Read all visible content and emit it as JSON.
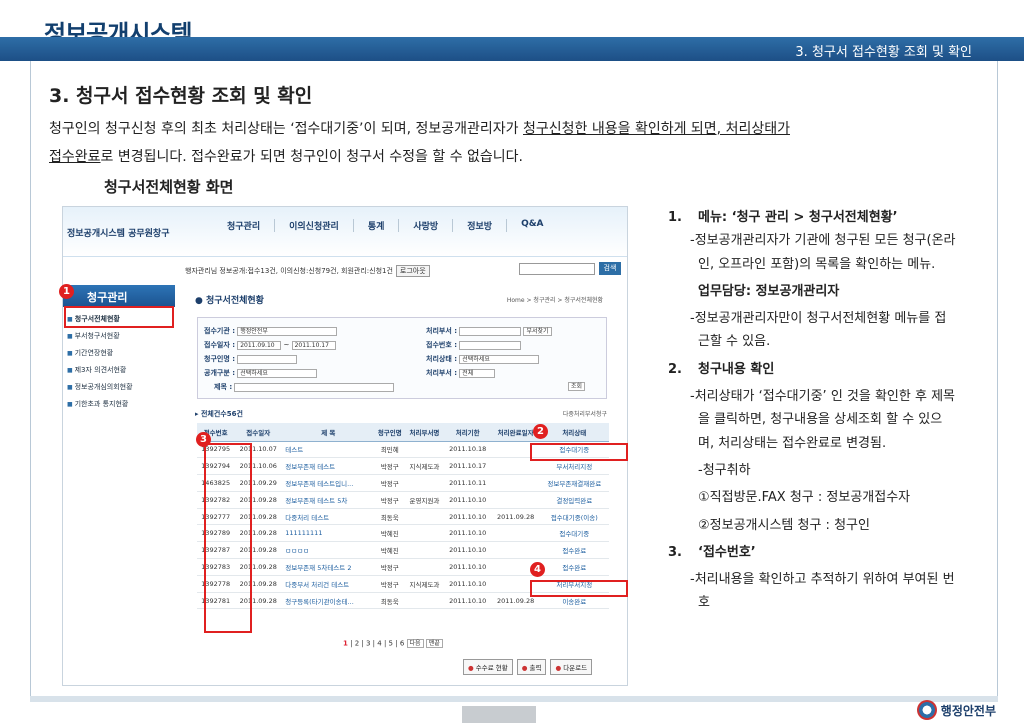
{
  "header": {
    "logo": "정보공개시스템",
    "section": "3. 청구서 접수현황 조회 및 확인"
  },
  "main": {
    "title": "3. 청구서 접수현황 조회 및 확인",
    "para_plain1": "  청구인의 청구신청 후의 최초 처리상태는 ‘접수대기중’이 되며, 정보공개관리자가 ",
    "para_u1": "청구신청한 내용을 확인하게 되면, 처리상태가",
    "para_u2": "접수완료",
    "para_plain2": "로 변경됩니다. 접수완료가 되면 청구인이 청구서 수정을 할 수 없습니다.",
    "subtitle": "청구서전체현황 화면"
  },
  "shot": {
    "site_title": "정보공개시스템 공무원창구",
    "nav": [
      "청구관리",
      "이의신청관리",
      "통계",
      "사랑방",
      "정보방",
      "Q&A"
    ],
    "user_info": "행자관리님    정보공개:접수13건, 이의신청:신청79건, 회원관리:신청1건",
    "logout": "로그아웃",
    "search_btn": "검색",
    "side_head": "청구관리",
    "side_items": [
      "청구서전체현황",
      "부서청구서현황",
      "기간연장현황",
      "제3자 의견서현황",
      "정보공개심의회현황",
      "기한초과 통지현황"
    ],
    "crumb_title": "청구서전체현황",
    "path": "Home > 청구관리 > 청구서전체현황",
    "form": {
      "agency_l": "접수기관 :",
      "agency_v": "행정안전부",
      "date_l": "접수일자 :",
      "date_from": "2011.09.10",
      "date_sep": "~",
      "date_to": "2011.10.17",
      "name_l": "청구인명 :",
      "type_l": "공개구분 :",
      "type_v": "선택하세요",
      "title_l": "제목 :",
      "dept_l": "처리부서 :",
      "dept_btn": "부서찾기",
      "recv_l": "접수번호 :",
      "state_l": "처리상태 :",
      "state_v": "선택하세요",
      "mgr_l": "처리부서 :",
      "mgr_v": "전체",
      "query_btn": "조회"
    },
    "count": "전체건수56건",
    "multi_dl": "다중처리부서청구",
    "columns": [
      "접수번호",
      "접수일자",
      "제 목",
      "청구인명",
      "처리부서명",
      "처리기한",
      "처리완료일자",
      "처리상태"
    ],
    "rows": [
      [
        "1392795",
        "2011.10.07",
        "테스트",
        "최민혜",
        "",
        "2011.10.18",
        "",
        "접수대기중"
      ],
      [
        "1392794",
        "2011.10.06",
        "정보부존재 테스트",
        "박정구",
        "지식제도과",
        "2011.10.17",
        "",
        "부서처리지정"
      ],
      [
        "1463825",
        "2011.09.29",
        "정보부존재 테스트입니...",
        "박정구",
        "",
        "2011.10.11",
        "",
        "정보부존재결재완료"
      ],
      [
        "1392782",
        "2011.09.28",
        "정보부존재 테스트 5차",
        "박정구",
        "운영지원과",
        "2011.10.10",
        "",
        "결정입력완료"
      ],
      [
        "1392777",
        "2011.09.28",
        "다중처리 테스트",
        "최동욱",
        "",
        "2011.10.10",
        "2011.09.28",
        "접수대기중(이송)"
      ],
      [
        "1392789",
        "2011.09.28",
        "111111111",
        "박혜진",
        "",
        "2011.10.10",
        "",
        "접수대기중"
      ],
      [
        "1392787",
        "2011.09.28",
        "ㅁㅁㅁㅁ",
        "박혜진",
        "",
        "2011.10.10",
        "",
        "접수완료"
      ],
      [
        "1392783",
        "2011.09.28",
        "정보부존재 5차테스트 2",
        "박정구",
        "",
        "2011.10.10",
        "",
        "접수완료"
      ],
      [
        "1392778",
        "2011.09.28",
        "다중부서 처리건 테스트",
        "박정구",
        "지식제도과",
        "2011.10.10",
        "",
        "처리부서지정"
      ],
      [
        "1392781",
        "2011.09.28",
        "청구등록(타기관이송테...",
        "최동욱",
        "",
        "2011.10.10",
        "2011.09.28",
        "이송완료"
      ]
    ],
    "pager": {
      "pages": [
        "1",
        "2",
        "3",
        "4",
        "5",
        "6"
      ],
      "next": "다음",
      "last": "맨끝"
    },
    "buttons": [
      "수수료 현황",
      "출력",
      "다운로드"
    ]
  },
  "callouts": [
    "1",
    "2",
    "3",
    "4"
  ],
  "right": {
    "i1_n": "1.",
    "i1_h": "메뉴: ‘청구 관리 > 청구서전체현황’",
    "i1_d1": "-정보공개관리자가 기관에 청구된 모든 청구(온라인, 오프라인 포함)의 목록을 확인하는 메뉴.",
    "i1_role": "업무담당: 정보공개관리자",
    "i1_d2": "-정보공개관리자만이 청구서전체현황 메뉴를 접근할 수 있음.",
    "i2_n": "2.",
    "i2_h": "청구내용 확인",
    "i2_d1": "-처리상태가 ‘접수대기중’ 인 것을 확인한 후 제목을 클릭하면, 청구내용을 상세조회 할 수 있으며, 처리상태는 접수완료로 변경됨.",
    "i2_d2": "-청구취하",
    "i2_d3": "①직접방문.FAX 청구 : 정보공개접수자",
    "i2_d4": "②정보공개시스템 청구 : 청구인",
    "i3_n": "3.",
    "i3_h": "‘접수번호’",
    "i3_d1": "-처리내용을 확인하고 추적하기 위하여 부여된 번호"
  },
  "footer": {
    "gov": "행정안전부"
  }
}
